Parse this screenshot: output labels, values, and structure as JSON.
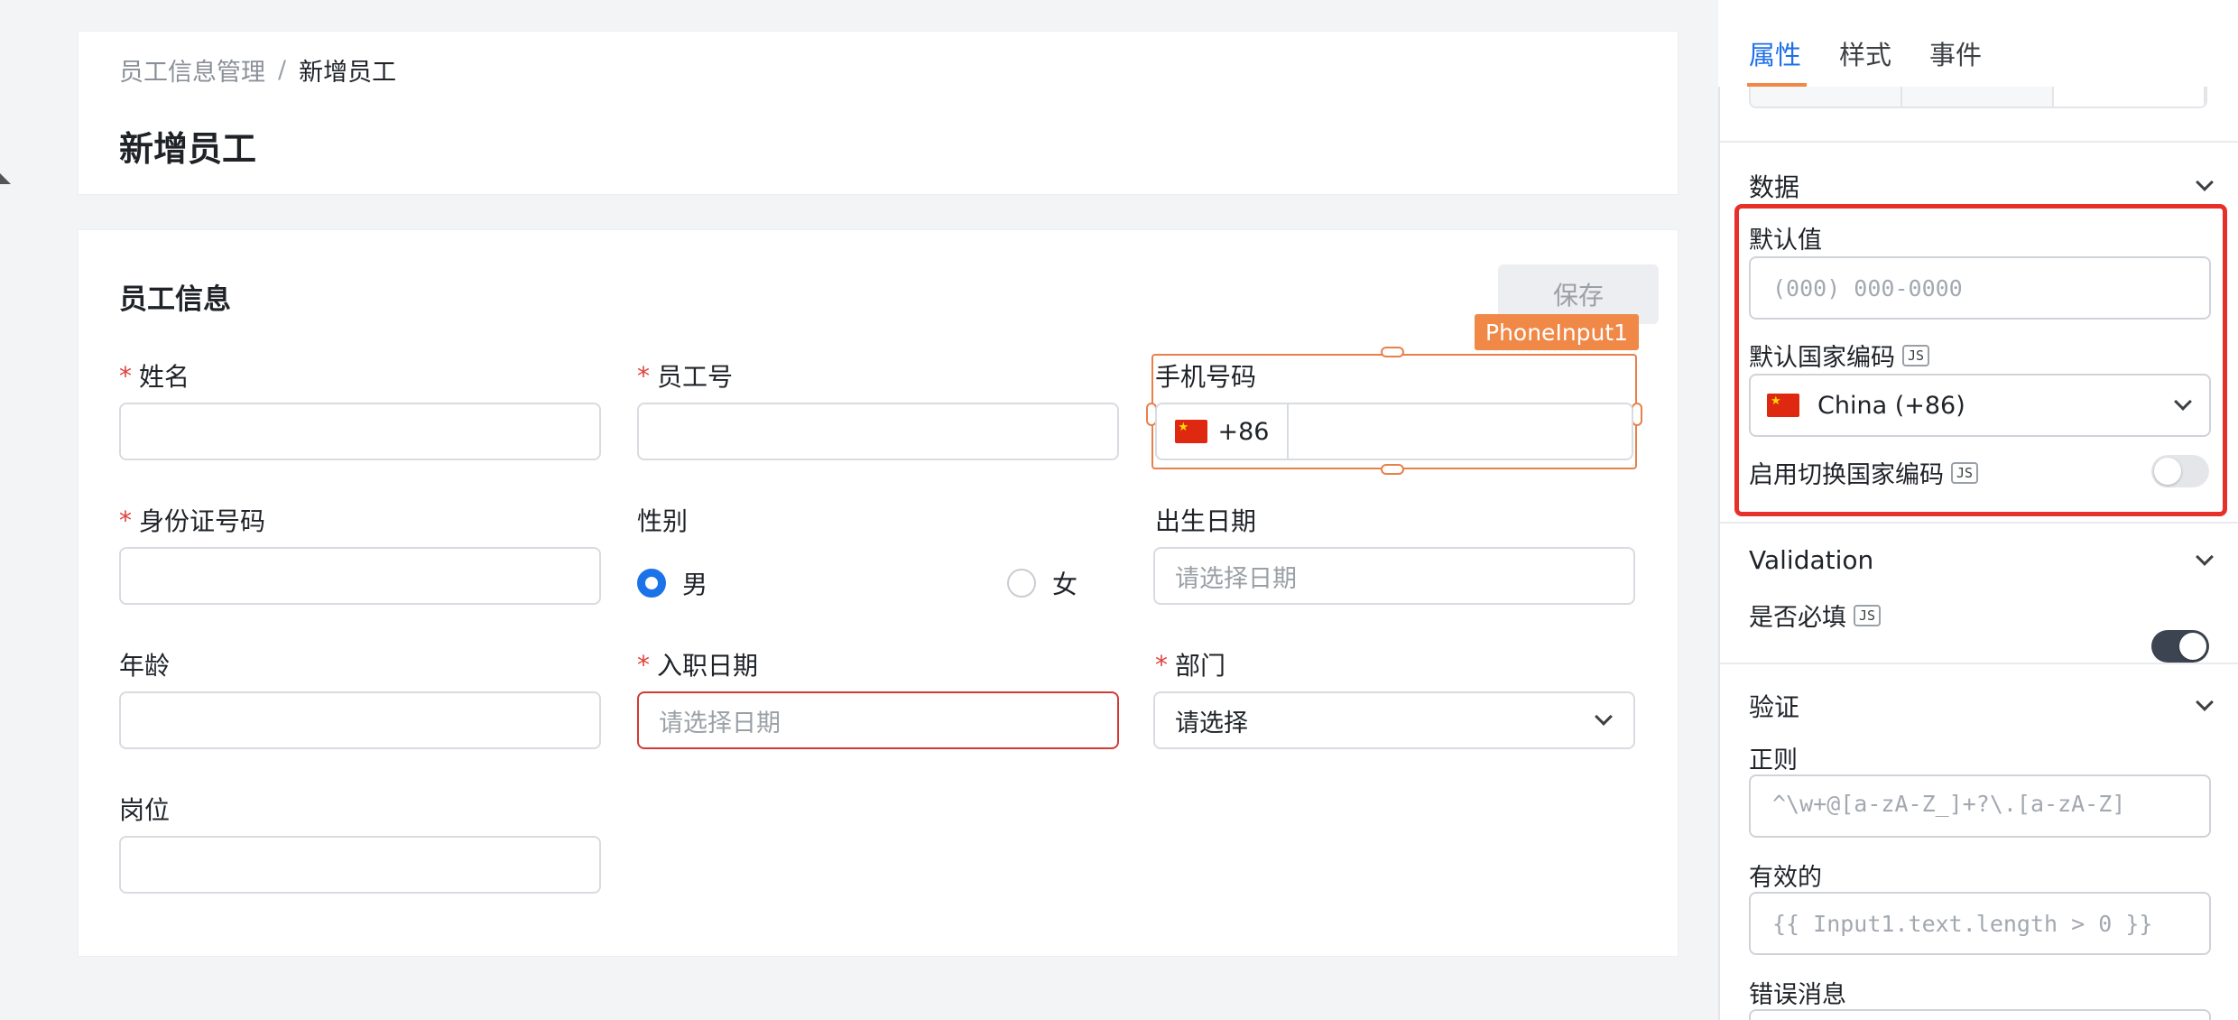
{
  "breadcrumb": {
    "parent": "员工信息管理",
    "separator": "/",
    "current": "新增员工"
  },
  "page_title": "新增员工",
  "form": {
    "section_title": "员工信息",
    "save_label": "保存",
    "fields": {
      "name_label": "姓名",
      "employee_no_label": "员工号",
      "phone_label": "手机号码",
      "id_card_label": "身份证号码",
      "gender_label": "性别",
      "gender_male": "男",
      "gender_female": "女",
      "birth_label": "出生日期",
      "birth_placeholder": "请选择日期",
      "age_label": "年龄",
      "hire_label": "入职日期",
      "hire_placeholder": "请选择日期",
      "dept_label": "部门",
      "dept_placeholder": "请选择",
      "position_label": "岗位"
    },
    "required_mark": "*",
    "phone": {
      "component_tag": "PhoneInput1",
      "country_code": "+86"
    }
  },
  "panel": {
    "tabs": [
      "属性",
      "样式",
      "事件"
    ],
    "active_tab": "属性",
    "data_section": "数据",
    "default_value_label": "默认值",
    "default_value_placeholder": "(000) 000-0000",
    "default_country_label": "默认国家编码",
    "default_country_value": "China (+86)",
    "enable_switch_label": "启用切换国家编码",
    "enable_switch_on": false,
    "js_badge": "JS",
    "validation_section": "Validation",
    "required_label": "是否必填",
    "required_on": true,
    "verify_section": "验证",
    "regex_label": "正则",
    "regex_value": "^\\w+@[a-zA-Z_]+?\\.[a-zA-Z]",
    "valid_label": "有效的",
    "valid_value": "{{ Input1.text.length > 0 }}",
    "error_label": "错误消息"
  },
  "colors": {
    "accent": "#1f6feb",
    "selection": "#e8804a",
    "highlight": "#e8302a",
    "error": "#d43a35"
  }
}
